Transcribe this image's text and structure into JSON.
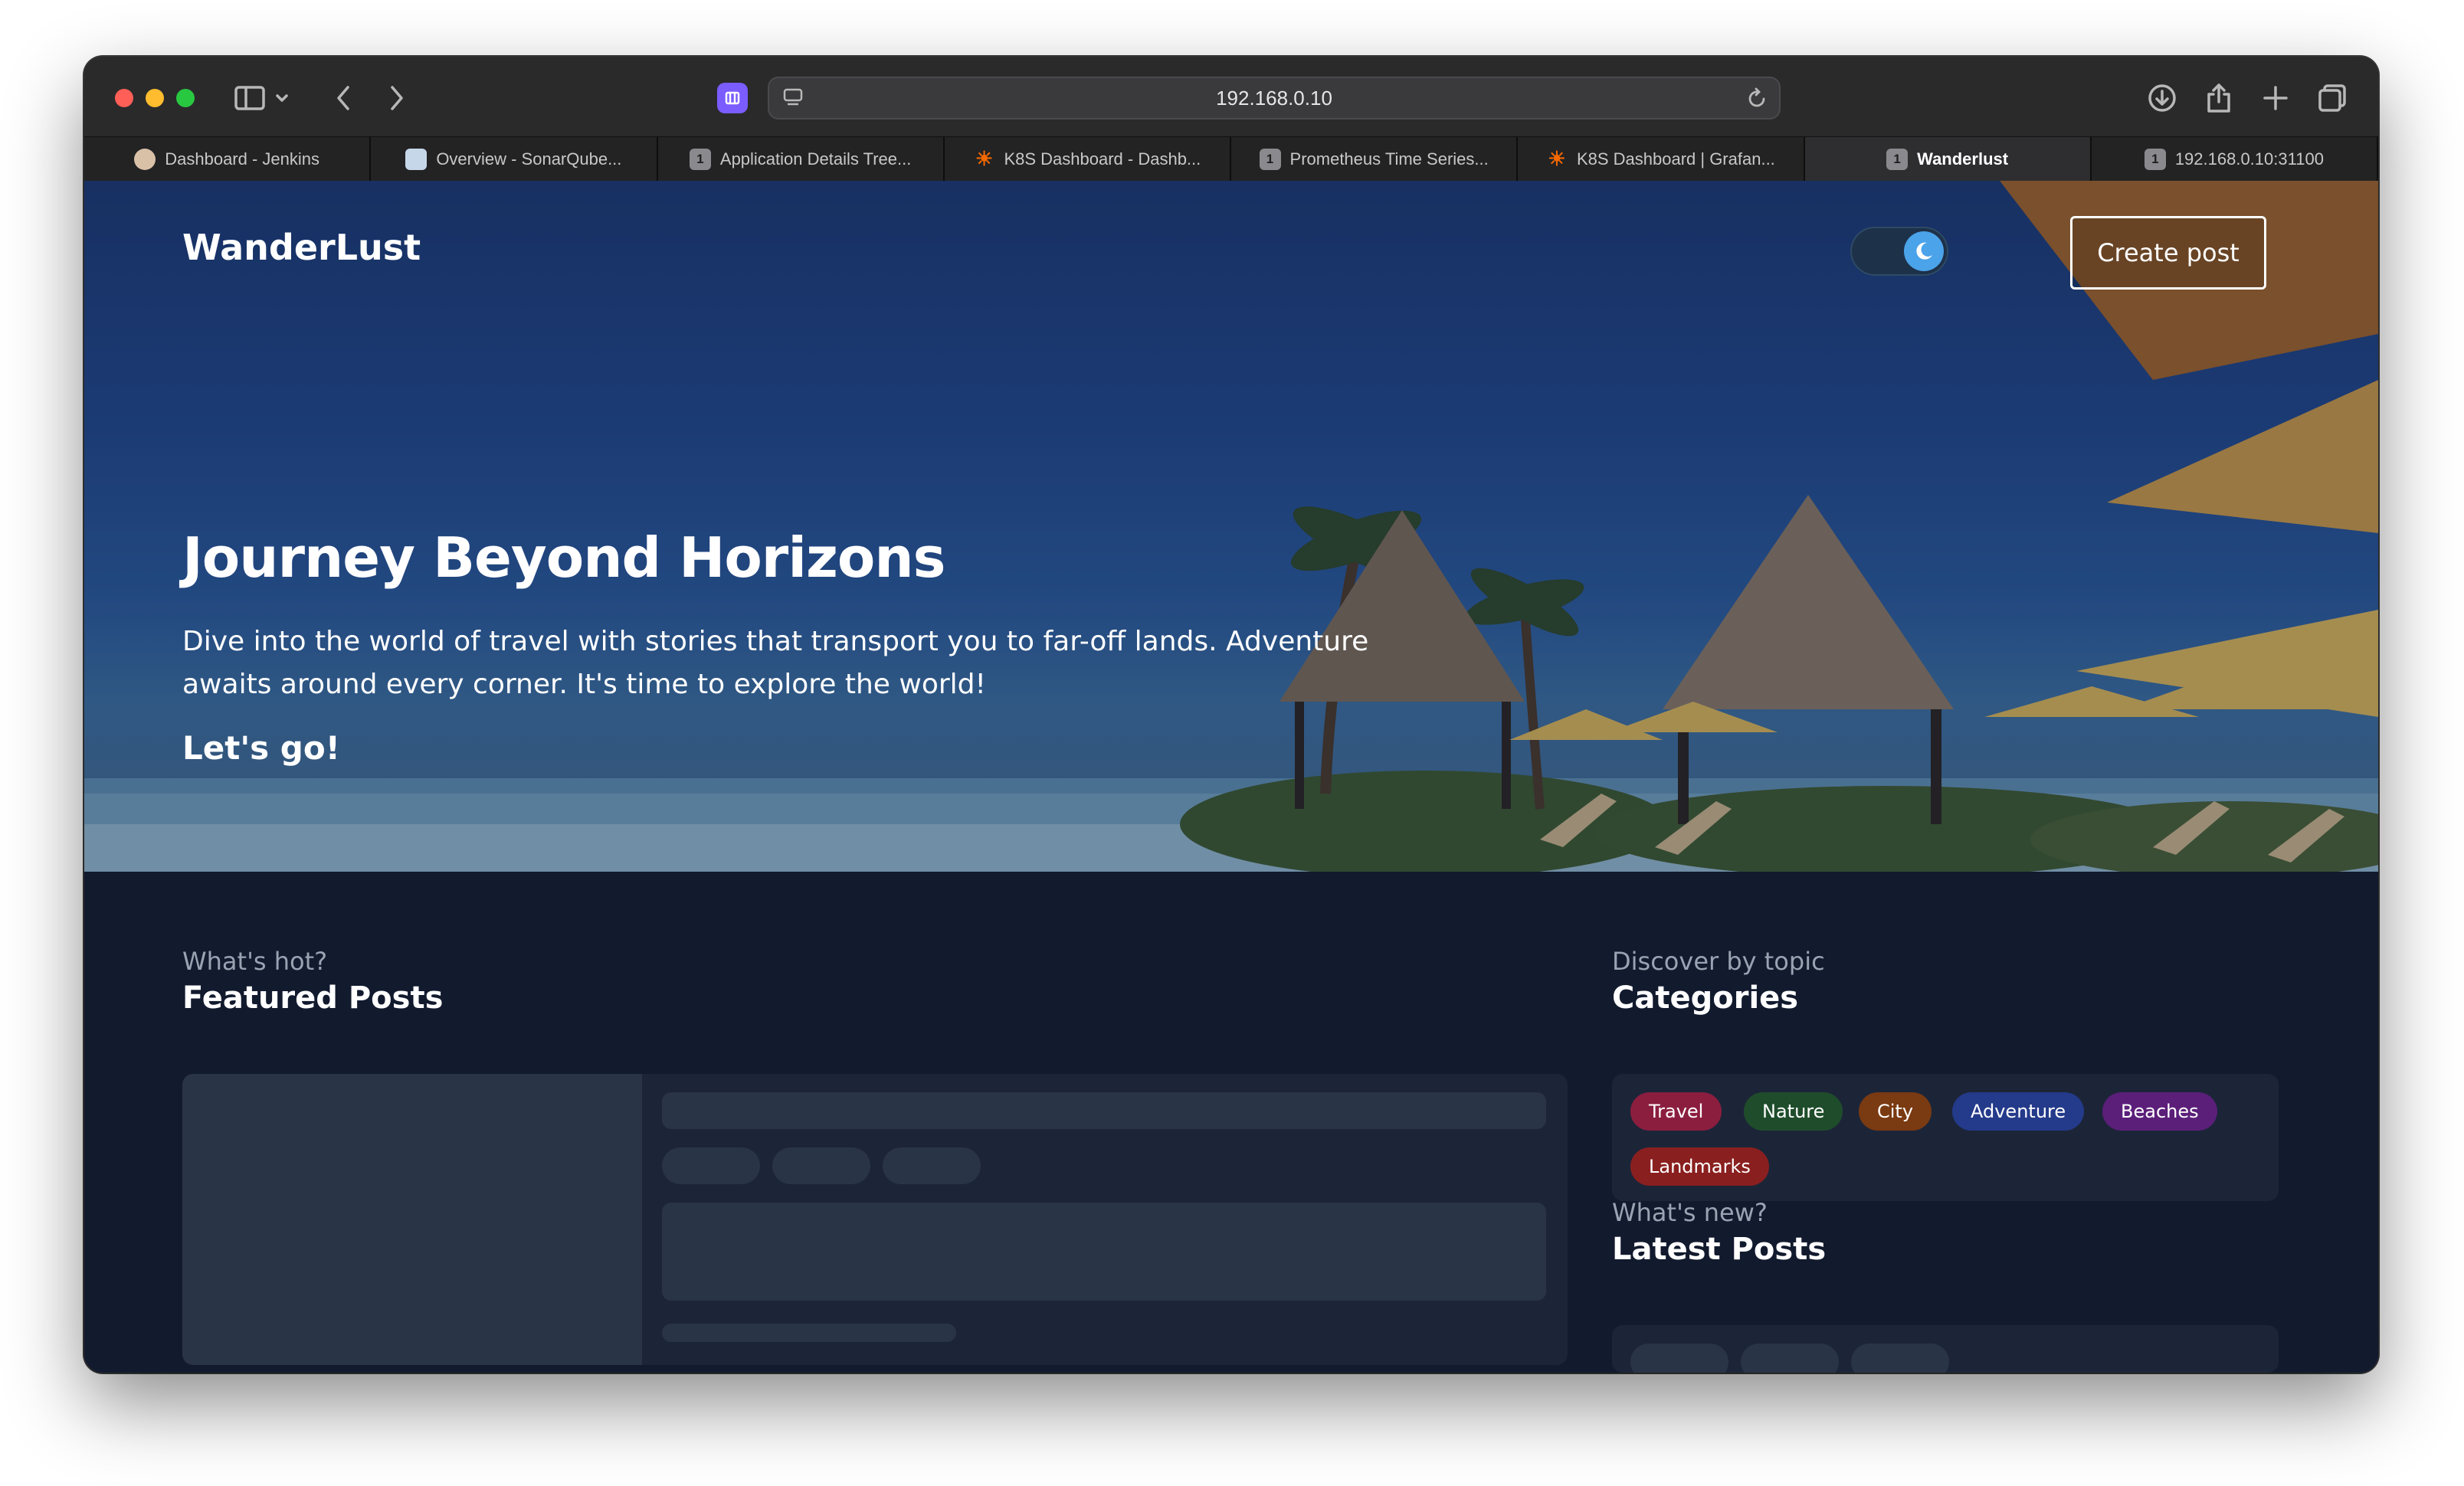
{
  "browser": {
    "url": "192.168.0.10",
    "tabs": [
      {
        "label": "Dashboard - Jenkins",
        "icon": "jenkins-icon"
      },
      {
        "label": "Overview - SonarQube...",
        "icon": "sonarqube-icon"
      },
      {
        "label": "Application Details Tree...",
        "icon": "1"
      },
      {
        "label": "K8S Dashboard - Dashb...",
        "icon": "grafana-icon"
      },
      {
        "label": "Prometheus Time Series...",
        "icon": "1"
      },
      {
        "label": "K8S Dashboard | Grafan...",
        "icon": "grafana-icon"
      },
      {
        "label": "Wanderlust",
        "icon": "1",
        "active": true
      },
      {
        "label": "192.168.0.10:31100",
        "icon": "1"
      }
    ],
    "tab_number": "1"
  },
  "header": {
    "brand": "WanderLust",
    "create_post_label": "Create post",
    "theme_toggle": "dark"
  },
  "hero": {
    "title": "Journey Beyond Horizons",
    "subtitle": "Dive into the world of travel with stories that transport you to far-off lands. Adventure awaits around every corner. It's time to explore the world!",
    "cta": "Let's go!"
  },
  "featured": {
    "eyebrow": "What's hot?",
    "title": "Featured Posts"
  },
  "categories": {
    "eyebrow": "Discover by topic",
    "title": "Categories",
    "items": [
      {
        "label": "Travel",
        "color": "#8b1e3f"
      },
      {
        "label": "Nature",
        "color": "#1f4d2b"
      },
      {
        "label": "City",
        "color": "#7a3a12"
      },
      {
        "label": "Adventure",
        "color": "#243a8a"
      },
      {
        "label": "Beaches",
        "color": "#5b1f7a"
      },
      {
        "label": "Landmarks",
        "color": "#8a1f1f"
      }
    ]
  },
  "latest": {
    "eyebrow": "What's new?",
    "title": "Latest Posts"
  }
}
